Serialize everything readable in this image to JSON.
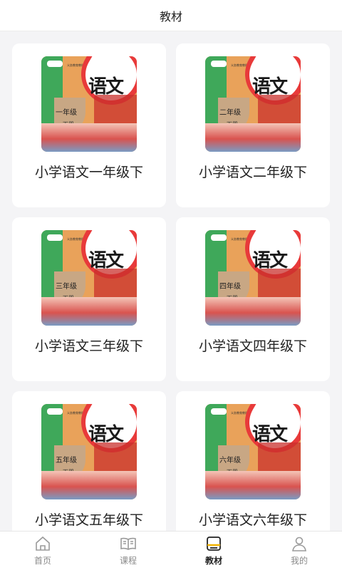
{
  "header": {
    "title": "教材"
  },
  "books": [
    {
      "name": "小学语文一年级下",
      "cover_grade": "一年级",
      "cover_volume": "下册"
    },
    {
      "name": "小学语文二年级下",
      "cover_grade": "二年级",
      "cover_volume": "下册"
    },
    {
      "name": "小学语文三年级下",
      "cover_grade": "三年级",
      "cover_volume": "下册"
    },
    {
      "name": "小学语文四年级下",
      "cover_grade": "四年级",
      "cover_volume": "下册"
    },
    {
      "name": "小学语文五年级下",
      "cover_grade": "五年级",
      "cover_volume": "下册"
    },
    {
      "name": "小学语文六年级下",
      "cover_grade": "六年级",
      "cover_volume": "下册"
    }
  ],
  "cover_common": {
    "title": "语文",
    "publisher_line": "义务教育教科书"
  },
  "nav": [
    {
      "label": "首页",
      "icon": "home-icon"
    },
    {
      "label": "课程",
      "icon": "open-book-icon"
    },
    {
      "label": "教材",
      "icon": "textbook-icon",
      "active": true
    },
    {
      "label": "我的",
      "icon": "user-icon"
    }
  ],
  "colors": {
    "active": "#222222",
    "inactive": "#8a8a8a",
    "background": "#f4f4f6"
  }
}
